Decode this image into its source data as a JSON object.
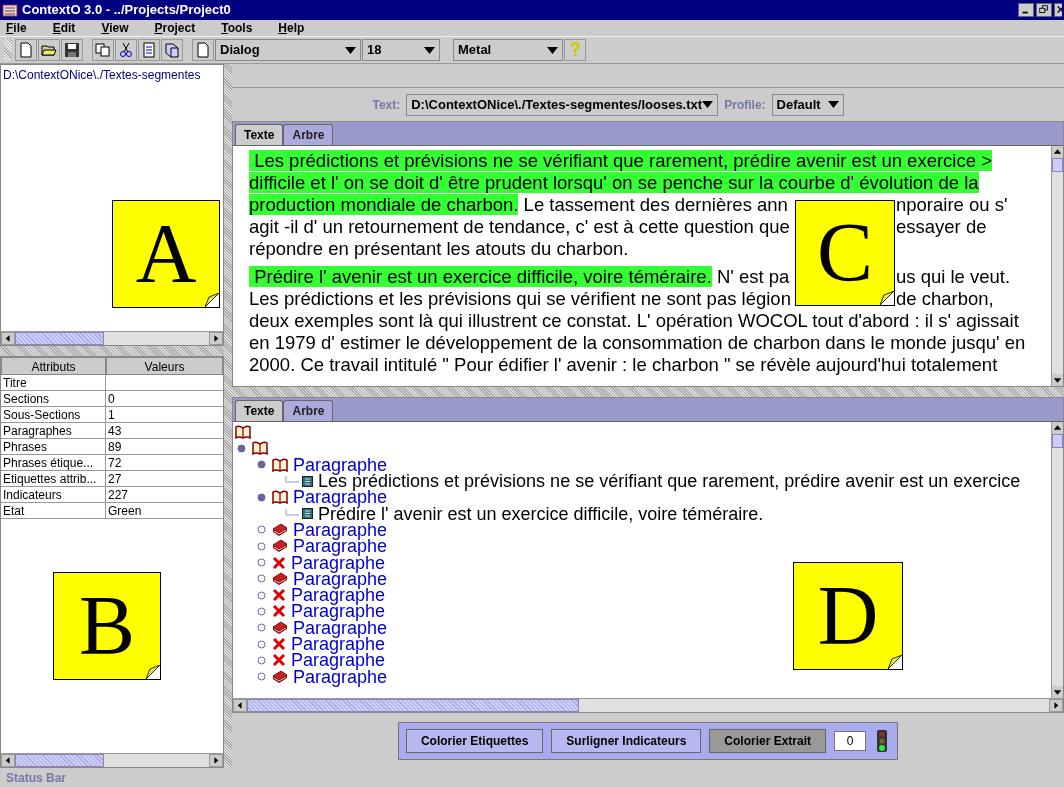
{
  "window": {
    "title": "ContextO 3.0 - ../Projects/Project0"
  },
  "menu": [
    "File",
    "Edit",
    "View",
    "Project",
    "Tools",
    "Help"
  ],
  "toolbar": {
    "font": "Dialog",
    "size": "18",
    "look": "Metal"
  },
  "file_path": "D:\\ContextONice\\./Textes-segmentes",
  "attributes": {
    "columns": [
      "Attributs",
      "Valeurs"
    ],
    "rows": [
      {
        "name": "Titre"
      },
      {
        "name": "Sections",
        "value": "0"
      },
      {
        "name": "Sous-Sections",
        "value": "1"
      },
      {
        "name": "Paragraphes",
        "value": "43"
      },
      {
        "name": "Phrases",
        "value": "89"
      },
      {
        "name": "Phrases étique...",
        "value": "72"
      },
      {
        "name": "Etiquettes attrib...",
        "value": "27"
      },
      {
        "name": "Indicateurs",
        "value": "227"
      },
      {
        "name": "Etat",
        "value": "Green"
      }
    ]
  },
  "text_selector": {
    "label": "Text:",
    "value": "D:\\ContextONice\\./Textes-segmentes/looses.txt"
  },
  "profile_selector": {
    "label": "Profile:",
    "value": "Default"
  },
  "upper_tabs": [
    {
      "label": "Texte",
      "selected": true
    },
    {
      "label": "Arbre",
      "selected": false
    }
  ],
  "text_paragraphs": [
    [
      {
        "left": [
          {
            "text": " Les prédictions et prévisions ne se vérifiant que rarement, prédire avenir est un exercice >",
            "highlighted": true
          }
        ]
      },
      {
        "left": [
          {
            "text": "difficile et l' on se doit d' être prudent lorsqu' on se penche sur la courbe d' évolution de la",
            "highlighted": true
          }
        ]
      },
      {
        "left": [
          {
            "text": "production mondiale de charbon.",
            "highlighted": true
          },
          {
            "text": " Le tassement des dernières ann",
            "highlighted": false
          }
        ],
        "right": [
          {
            "text": "nporaire ou s'",
            "highlighted": false
          }
        ]
      },
      {
        "left": [
          {
            "text": "agit -il d' un retournement de tendance, c' est à cette question que",
            "highlighted": false
          }
        ],
        "right": [
          {
            "text": "essayer de",
            "highlighted": false
          }
        ]
      },
      {
        "left": [
          {
            "text": "répondre en présentant les atouts du charbon.",
            "highlighted": false
          }
        ]
      }
    ],
    [
      {
        "left": [
          {
            "text": " Prédire l' avenir est un exercice difficile, voire téméraire.",
            "highlighted": true
          },
          {
            "text": " N' est pa",
            "highlighted": false
          }
        ],
        "right": [
          {
            "text": "us qui le veut.",
            "highlighted": false
          }
        ]
      },
      {
        "left": [
          {
            "text": "Les prédictions et les prévisions qui se vérifient ne sont pas légion",
            "highlighted": false
          }
        ],
        "right": [
          {
            "text": "de charbon,",
            "highlighted": false
          }
        ]
      },
      {
        "left": [
          {
            "text": "deux exemples sont là qui illustrent ce constat. L' opération WOCOL tout d'abord : il s' agissait",
            "highlighted": false
          }
        ]
      },
      {
        "left": [
          {
            "text": "en 1979 d' estimer le développement de la consommation de charbon dans le monde jusqu' en",
            "highlighted": false
          }
        ]
      },
      {
        "left": [
          {
            "text": "2000. Ce travail intitulé \" Pour édifier l' avenir : le charbon \" se révèle aujourd'hui totalement",
            "highlighted": false
          }
        ]
      }
    ]
  ],
  "lower_tabs": [
    {
      "label": "Texte",
      "selected": true
    },
    {
      "label": "Arbre",
      "selected": false
    }
  ],
  "tree": {
    "kind": "open-book",
    "children": [
      {
        "kind": "open-book",
        "expanded": true,
        "children": [
          {
            "kind": "open-book",
            "label": "Paragraphe",
            "expanded": true,
            "children": [
              {
                "kind": "sentence",
                "label": "Les prédictions et prévisions ne se vérifiant que rarement, prédire avenir est un exercice"
              }
            ]
          },
          {
            "kind": "open-book",
            "label": "Paragraphe",
            "expanded": true,
            "children": [
              {
                "kind": "sentence",
                "label": "Prédire l' avenir est un exercice difficile, voire téméraire."
              }
            ]
          },
          {
            "kind": "closed-book",
            "label": "Paragraphe",
            "expanded": false
          },
          {
            "kind": "closed-book",
            "label": "Paragraphe",
            "expanded": false
          },
          {
            "kind": "cross",
            "label": "Paragraphe",
            "expanded": false
          },
          {
            "kind": "closed-book",
            "label": "Paragraphe",
            "expanded": false
          },
          {
            "kind": "cross",
            "label": "Paragraphe",
            "expanded": false
          },
          {
            "kind": "cross",
            "label": "Paragraphe",
            "expanded": false
          },
          {
            "kind": "closed-book",
            "label": "Paragraphe",
            "expanded": false
          },
          {
            "kind": "cross",
            "label": "Paragraphe",
            "expanded": false
          },
          {
            "kind": "cross",
            "label": "Paragraphe",
            "expanded": false
          },
          {
            "kind": "closed-book",
            "label": "Paragraphe",
            "expanded": false
          }
        ]
      }
    ]
  },
  "actions": [
    {
      "label": "Colorier Etiquettes",
      "pressed": false
    },
    {
      "label": "Surligner Indicateurs",
      "pressed": false
    },
    {
      "label": "Colorier Extrait",
      "pressed": true
    }
  ],
  "counter": "0",
  "status_bar": "Status Bar",
  "callouts": [
    "A",
    "C",
    "B",
    "D"
  ]
}
